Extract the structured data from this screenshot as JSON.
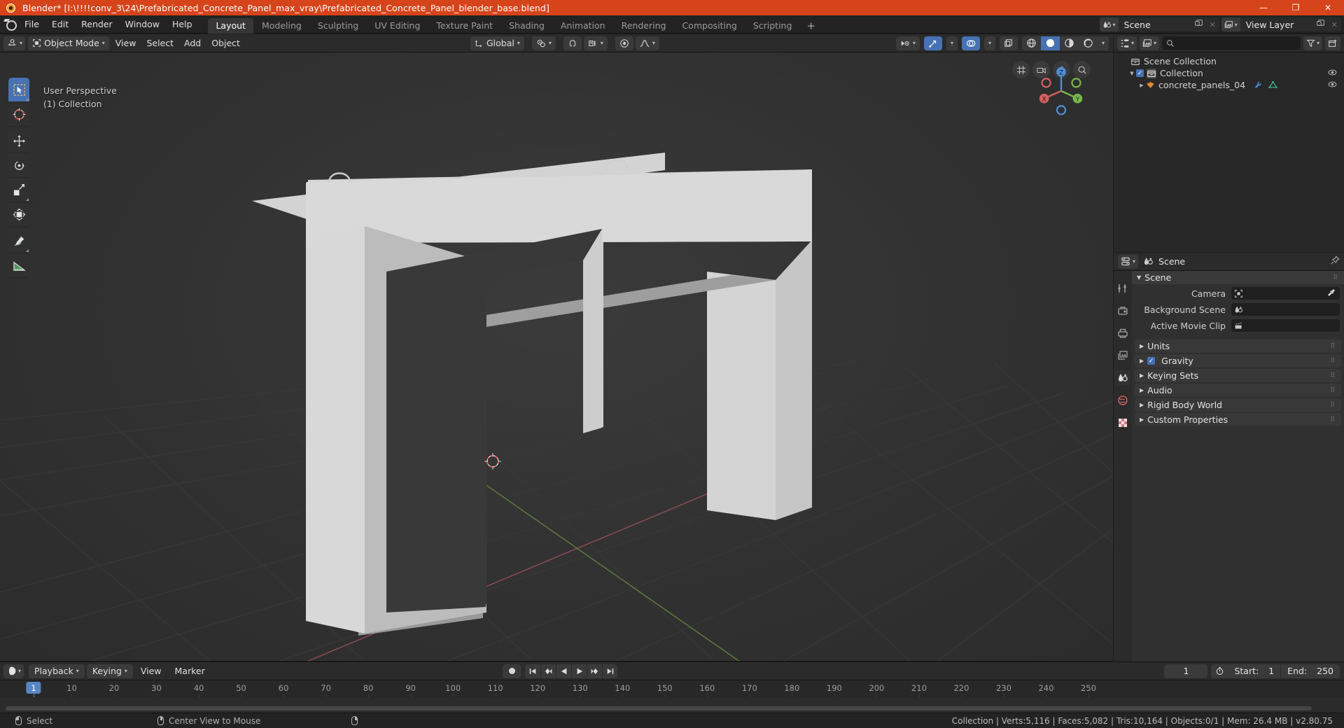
{
  "window": {
    "title": "Blender* [I:\\!!!!conv_3\\24\\Prefabricated_Concrete_Panel_max_vray\\Prefabricated_Concrete_Panel_blender_base.blend]",
    "app_icon": "blender-logo-icon",
    "minimize": "—",
    "maximize": "❐",
    "close": "✕"
  },
  "topbar": {
    "menus": [
      "File",
      "Edit",
      "Render",
      "Window",
      "Help"
    ],
    "workspaces": [
      {
        "label": "Layout",
        "active": true
      },
      {
        "label": "Modeling",
        "active": false
      },
      {
        "label": "Sculpting",
        "active": false
      },
      {
        "label": "UV Editing",
        "active": false
      },
      {
        "label": "Texture Paint",
        "active": false
      },
      {
        "label": "Shading",
        "active": false
      },
      {
        "label": "Animation",
        "active": false
      },
      {
        "label": "Rendering",
        "active": false
      },
      {
        "label": "Compositing",
        "active": false
      },
      {
        "label": "Scripting",
        "active": false
      }
    ],
    "add_workspace": "+",
    "scene": {
      "label": "Scene",
      "new_icon": "copy-icon",
      "unlink_icon": "x-icon"
    },
    "view_layer": {
      "label": "View Layer",
      "new_icon": "copy-icon",
      "unlink_icon": "x-icon"
    }
  },
  "viewport": {
    "header": {
      "editor_type": "editor-type-icon",
      "mode": "Object Mode",
      "menus": [
        "View",
        "Select",
        "Add",
        "Object"
      ],
      "transform_orientation": "Global",
      "snap_icon": "magnet-icon",
      "snap_target": "snap-increment-icon",
      "proportional_icon": "proportional-edit-icon",
      "falloff_icon": "smooth-falloff-icon",
      "visibility_icon": "visibility-icon",
      "gizmo_icon": "gizmo-icon",
      "overlays_icon": "overlays-icon",
      "xray_icon": "xray-icon",
      "shading_modes": [
        "wireframe",
        "solid",
        "material",
        "rendered"
      ],
      "active_shading": "solid"
    },
    "overlay_text": {
      "perspective": "User Perspective",
      "collection": "(1) Collection"
    },
    "toolbar": [
      {
        "name": "select-box-tool",
        "active": true
      },
      {
        "name": "cursor-tool",
        "active": false
      },
      {
        "name": "move-tool",
        "active": false
      },
      {
        "name": "rotate-tool",
        "active": false
      },
      {
        "name": "scale-tool",
        "active": false
      },
      {
        "name": "transform-tool",
        "active": false
      },
      {
        "name": "annotate-tool",
        "active": false
      },
      {
        "name": "measure-tool",
        "active": false
      }
    ],
    "gizmo_axes": {
      "x": "X",
      "y": "Y",
      "z": "Z"
    },
    "nav_buttons": [
      "zoom-icon",
      "hand-icon",
      "camera-icon",
      "perspective-icon"
    ]
  },
  "outliner": {
    "display_mode_icon": "outliner-icon",
    "filter_id_icon": "view-layer-icon",
    "search_placeholder": "",
    "filter_icon": "filter-icon",
    "new_collection_icon": "new-collection-icon",
    "rows": [
      {
        "label": "Scene Collection",
        "indent": 0,
        "icon": "collection-icon",
        "expander": "",
        "checkbox": false,
        "eye": false,
        "extra": []
      },
      {
        "label": "Collection",
        "indent": 1,
        "icon": "collection-icon",
        "expander": "▼",
        "checkbox": true,
        "eye": true,
        "extra": []
      },
      {
        "label": "concrete_panels_04",
        "indent": 2,
        "icon": "object-mesh-icon",
        "expander": "▶",
        "checkbox": false,
        "eye": true,
        "extra": [
          "modifier-wrench-icon",
          "mesh-data-icon"
        ]
      }
    ]
  },
  "properties": {
    "editor_icon": "properties-editor-icon",
    "breadcrumb_icon": "scene-icon",
    "breadcrumb": "Scene",
    "pin_icon": "pin-icon",
    "tabs": [
      {
        "name": "tool-tab",
        "icon": "tool-icon",
        "active": false
      },
      {
        "name": "render-tab",
        "icon": "render-icon",
        "active": false
      },
      {
        "name": "output-tab",
        "icon": "printer-icon",
        "active": false
      },
      {
        "name": "view-layer-tab",
        "icon": "images-icon",
        "active": false
      },
      {
        "name": "scene-tab",
        "icon": "scene-icon",
        "active": true
      },
      {
        "name": "world-tab",
        "icon": "world-icon",
        "active": false
      },
      {
        "name": "texture-tab",
        "icon": "checker-icon",
        "active": false
      }
    ],
    "panels": [
      {
        "title": "Scene",
        "open": true,
        "checkbox": null,
        "fields": [
          {
            "label": "Camera",
            "value": "",
            "icon": "camera-data-icon",
            "eyedropper": true
          },
          {
            "label": "Background Scene",
            "value": "",
            "icon": "scene-icon",
            "eyedropper": false
          },
          {
            "label": "Active Movie Clip",
            "value": "",
            "icon": "movie-clip-icon",
            "eyedropper": false
          }
        ]
      },
      {
        "title": "Units",
        "open": false,
        "checkbox": null,
        "fields": []
      },
      {
        "title": "Gravity",
        "open": false,
        "checkbox": true,
        "fields": []
      },
      {
        "title": "Keying Sets",
        "open": false,
        "checkbox": null,
        "fields": []
      },
      {
        "title": "Audio",
        "open": false,
        "checkbox": null,
        "fields": []
      },
      {
        "title": "Rigid Body World",
        "open": false,
        "checkbox": null,
        "fields": []
      },
      {
        "title": "Custom Properties",
        "open": false,
        "checkbox": null,
        "fields": []
      }
    ]
  },
  "timeline": {
    "editor_icon": "timeline-editor-icon",
    "menus": [
      {
        "label": "Playback",
        "dropdown": true
      },
      {
        "label": "Keying",
        "dropdown": true
      },
      {
        "label": "View",
        "dropdown": false
      },
      {
        "label": "Marker",
        "dropdown": false
      }
    ],
    "record_icon": "record-icon",
    "transport": [
      "jump-start-icon",
      "prev-keyframe-icon",
      "play-reverse-icon",
      "play-icon",
      "next-keyframe-icon",
      "jump-end-icon"
    ],
    "current_frame": "1",
    "use_preview_range_icon": "stopwatch-icon",
    "start_label": "Start:",
    "start_value": "1",
    "end_label": "End:",
    "end_value": "250",
    "ticks": [
      1,
      10,
      20,
      30,
      40,
      50,
      60,
      70,
      80,
      90,
      100,
      110,
      120,
      130,
      140,
      150,
      160,
      170,
      180,
      190,
      200,
      210,
      220,
      230,
      240,
      250
    ],
    "playhead_frame": "1"
  },
  "statusbar": {
    "hints": [
      {
        "mouse": "left",
        "label": "Select"
      },
      {
        "mouse": "mid",
        "label": "Center View to Mouse"
      },
      {
        "mouse": "right",
        "label": ""
      }
    ],
    "stats": "Collection | Verts:5,116 | Faces:5,082 | Tris:10,164 | Objects:0/1 | Mem: 26.4 MB | v2.80.75"
  },
  "colors": {
    "accent_blue": "#4772b3",
    "title_orange": "#d6441b",
    "axis_x_red": "#b55",
    "axis_y_green": "#7a3",
    "object_grey": "#b4b4b4"
  }
}
